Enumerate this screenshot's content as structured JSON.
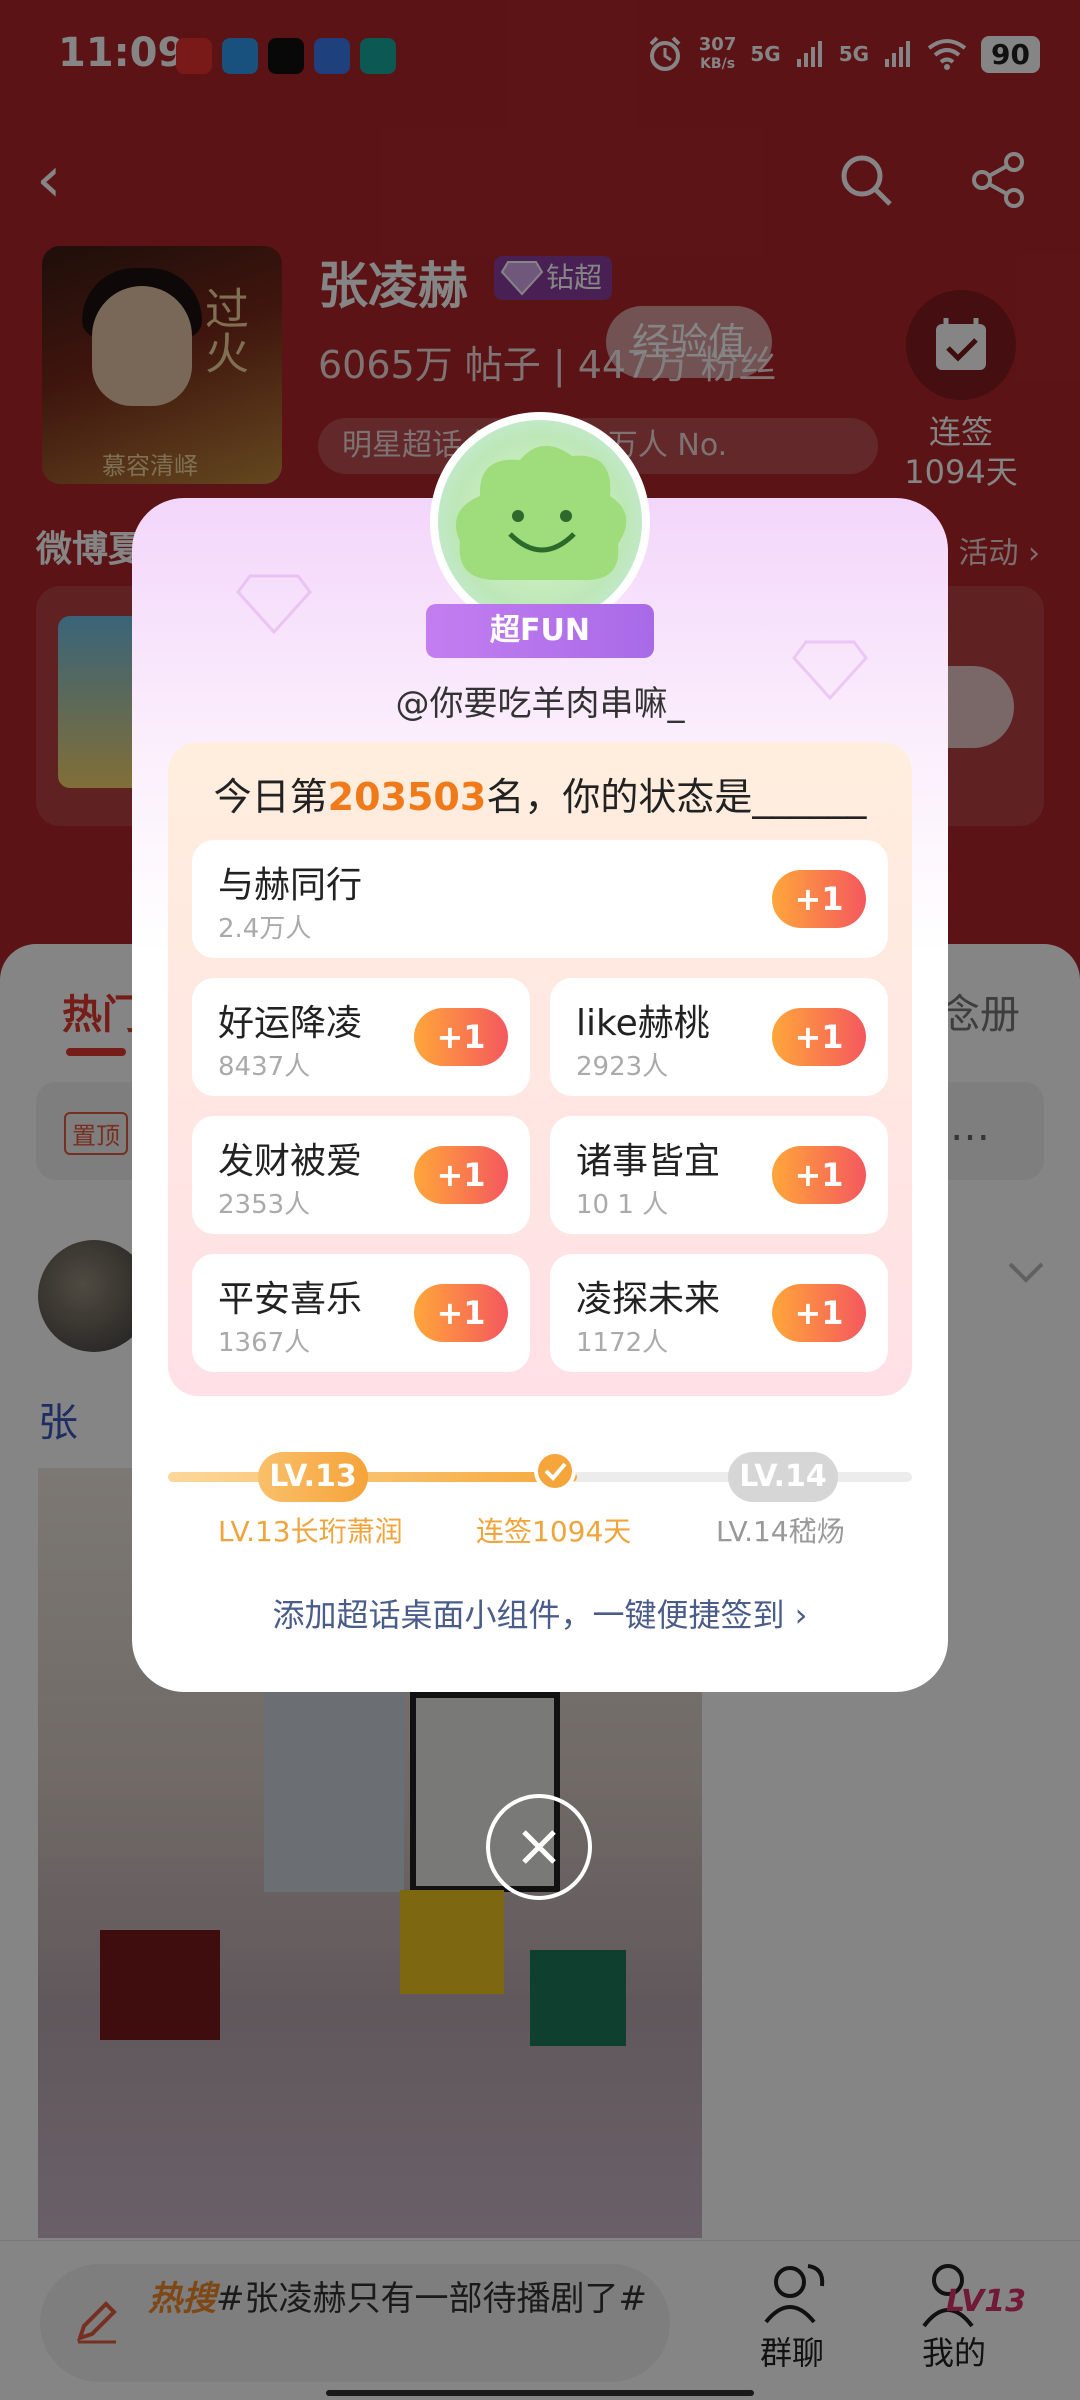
{
  "status_bar": {
    "time": "11:09",
    "net_speed_value": "307",
    "net_speed_unit": "KB/s",
    "signal_1": "5G",
    "signal_2": "5G",
    "battery": "90"
  },
  "header": {
    "star_name": "张凌赫",
    "badge": "钻超",
    "stats": "6065万 帖子 | 447万 粉丝",
    "exp_popup": "经验值",
    "rank_text": "明星超话 签到 20.3万人 No.",
    "checkin_label_1": "连签",
    "checkin_label_2": "1094天",
    "cover_title": "过火",
    "cover_subtitle": "慕容清峄"
  },
  "background": {
    "section_title": "微博夏",
    "activity_link": "活动 ›",
    "tab_hot": "热门",
    "tab_right": "念册",
    "pin_tag": "置顶",
    "more": "…",
    "post_tag": "张"
  },
  "bottom": {
    "hot_label": "热搜",
    "hot_text": "#张凌赫只有一部待播剧了#",
    "group_chat": "群聊",
    "me": "我的",
    "me_level": "LV13"
  },
  "modal": {
    "fun_badge": "超FUN",
    "username": "@你要吃羊肉串嘛_",
    "status_prefix": "今日第",
    "status_rank": "203503",
    "status_suffix": "名，你的状态是______",
    "options": [
      {
        "name": "与赫同行",
        "count": "2.4万人",
        "button": "+1"
      },
      {
        "name": "好运降凌",
        "count": "8437人",
        "button": "+1"
      },
      {
        "name": "like赫桃",
        "count": "2923人",
        "button": "+1"
      },
      {
        "name": "发财被爱",
        "count": "2353人",
        "button": "+1"
      },
      {
        "name": "诸事皆宜",
        "count": "10 1 人",
        "button": "+1"
      },
      {
        "name": "平安喜乐",
        "count": "1367人",
        "button": "+1"
      },
      {
        "name": "凌探未来",
        "count": "1172人",
        "button": "+1"
      }
    ],
    "progress": {
      "current_level": "LV.13",
      "next_level": "LV.14",
      "current_level_name": "LV.13长珩萧润",
      "streak": "连签1094天",
      "next_level_name": "LV.14嵇炀",
      "fill_fraction": 0.55
    },
    "widget_link": "添加超话桌面小组件，一键便捷签到 ›"
  },
  "colors": {
    "hero_red": "#b0262a",
    "accent_orange": "#f07a1a",
    "plus_gradient_start": "#ffa63a",
    "plus_gradient_end": "#f4585e",
    "link_blue": "#4a5c8a"
  }
}
